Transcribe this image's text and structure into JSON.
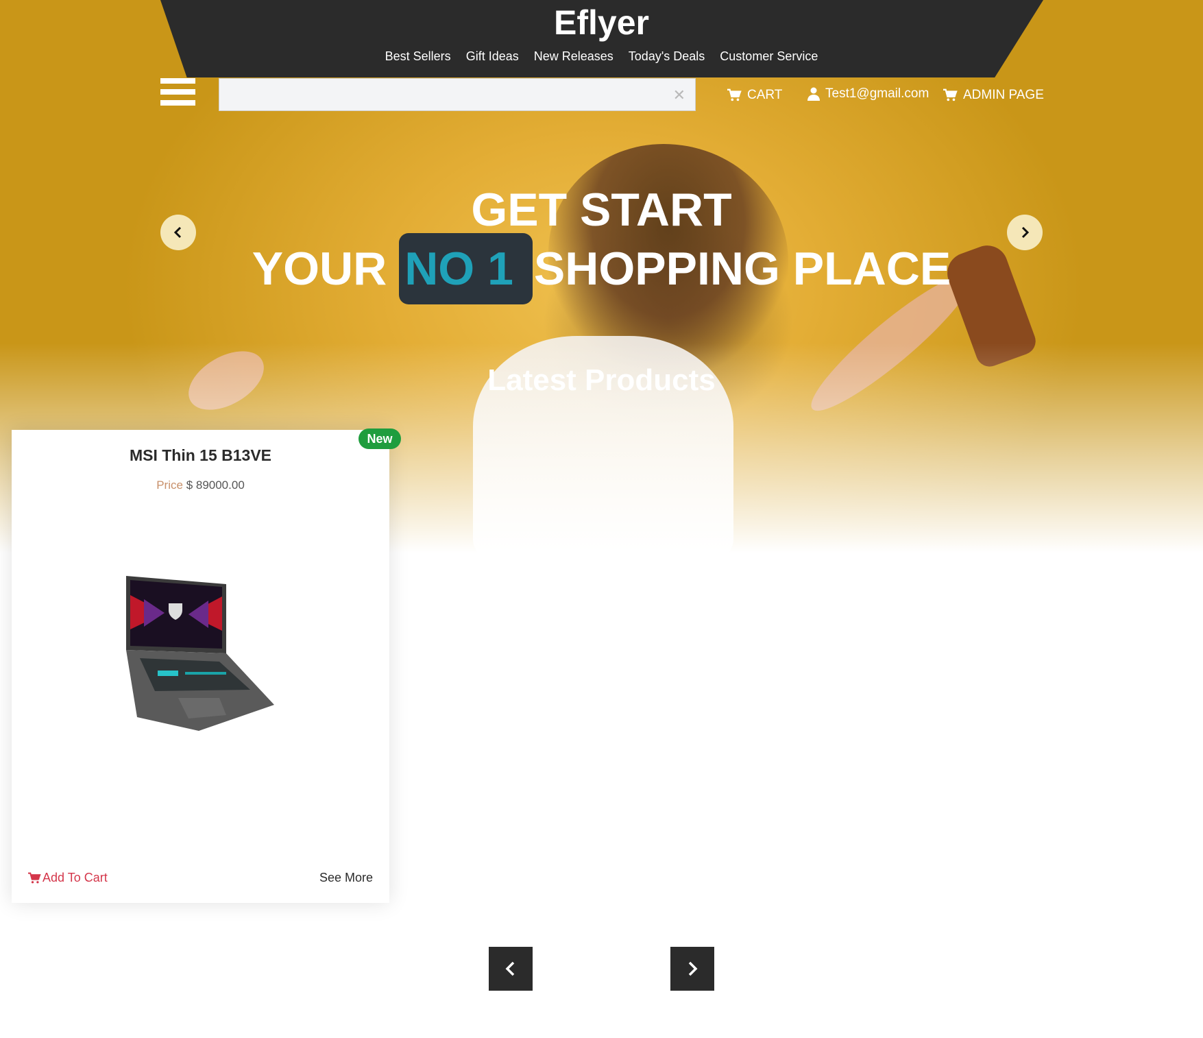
{
  "brand": "Eflyer",
  "nav": [
    "Best Sellers",
    "Gift Ideas",
    "New Releases",
    "Today's Deals",
    "Customer Service"
  ],
  "search": {
    "value": "",
    "placeholder": ""
  },
  "toolbar": {
    "cart_label": "CART",
    "user_email": "Test1@gmail.com",
    "admin_label": "ADMIN PAGE"
  },
  "hero": {
    "line1": "GET START",
    "line2_prefix": "YOUR",
    "line2_highlight": "NO 1",
    "line2_suffix": "SHOPPING PLACE",
    "section_title": "Latest Products"
  },
  "product": {
    "badge": "New",
    "title": "MSI Thin 15 B13VE",
    "price_label": "Price",
    "price_value": "$ 89000.00",
    "add_to_cart": "Add To Cart",
    "see_more": "See More"
  },
  "colors": {
    "header": "#2b2b2b",
    "accent_teal": "#1fa1b8",
    "badge_green": "#1f9d3e",
    "cart_red": "#d4364a",
    "hero_yellow": "#e3ad35"
  },
  "icons": {
    "menu": "hamburger-menu-icon",
    "cart": "shopping-cart-icon",
    "user": "user-icon",
    "prev": "chevron-left-icon",
    "next": "chevron-right-icon",
    "clear": "close-icon"
  }
}
